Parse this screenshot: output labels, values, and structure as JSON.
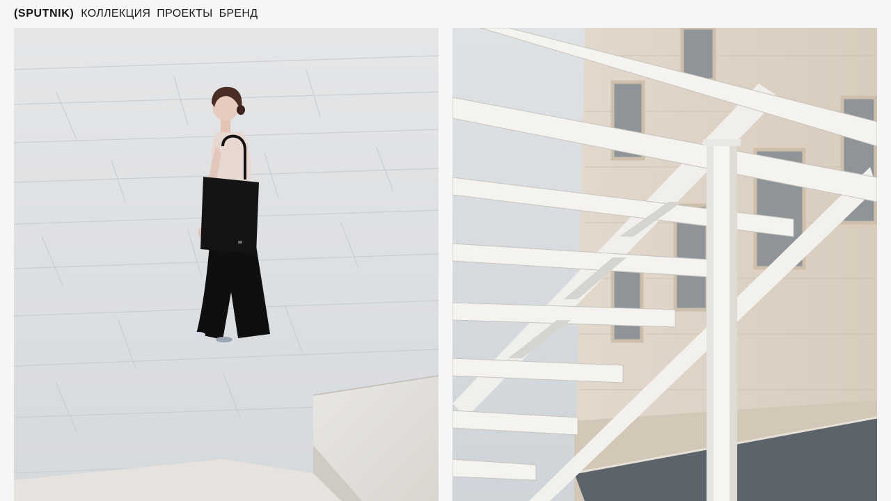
{
  "header": {
    "logo": "(SPUTNIK)",
    "nav": [
      {
        "label": "КОЛЛЕКЦИЯ"
      },
      {
        "label": "ПРОЕКТЫ"
      },
      {
        "label": "БРЕНД"
      }
    ]
  },
  "colors": {
    "background": "#f6f6f6",
    "text": "#1c1c1c"
  },
  "gallery": [
    {
      "subject": "woman-with-black-tote-on-stone-plaza"
    },
    {
      "subject": "white-steel-pergola-and-travertine-building"
    }
  ]
}
